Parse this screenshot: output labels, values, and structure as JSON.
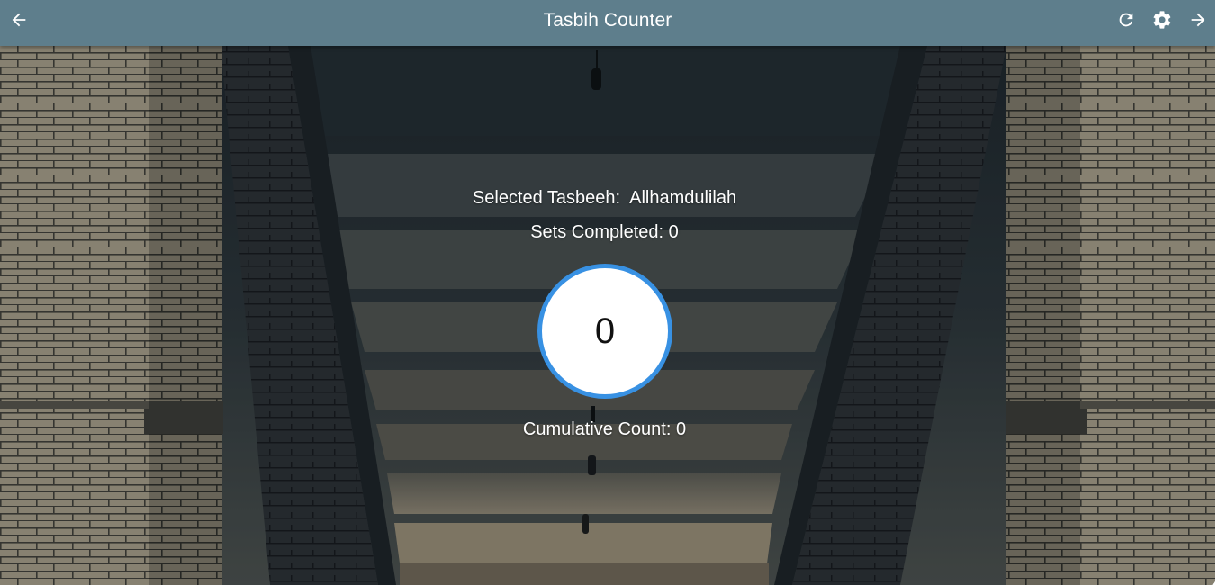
{
  "appbar": {
    "title": "Tasbih Counter",
    "icons": {
      "back": "arrow-left-icon",
      "refresh": "refresh-icon",
      "settings": "gear-icon",
      "forward": "arrow-right-icon"
    },
    "color": "#5e7e8c"
  },
  "main": {
    "selected_label": "Selected Tasbeeh:",
    "selected_value": "Allhamdulilah",
    "sets_label": "Sets Completed:",
    "sets_value": "0",
    "counter_value": "0",
    "cumulative_label": "Cumulative Count:",
    "cumulative_value": "0"
  },
  "colors": {
    "counter_ring": "#3891e3",
    "counter_fill": "#ffffff",
    "text": "#ffffff"
  }
}
